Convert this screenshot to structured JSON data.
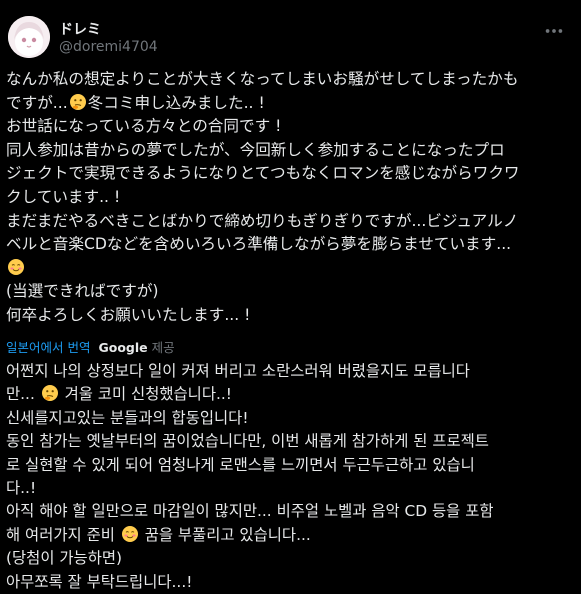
{
  "user": {
    "display_name": "ドレミ",
    "handle": "@doremi4704",
    "avatar_icon": "avatar-icon",
    "more_icon": "more-options-icon"
  },
  "tweet": {
    "original_lines": [
      {
        "before": "なんか私の想定よりことが大きくなってしまいお騒がせしてしまったかも",
        "emoji": "",
        "after": ""
      },
      {
        "before": "ですが...",
        "emoji": "thinking-face-emoji",
        "after": "冬コミ申し込みました.. !"
      },
      {
        "before": "お世話になっている方々との合同です !",
        "emoji": "",
        "after": ""
      },
      {
        "before": "同人参加は昔からの夢でしたが、今回新しく参加することになったプロ",
        "emoji": "",
        "after": ""
      },
      {
        "before": "ジェクトで実現できるようになりとてつもなくロマンを感じながらワクワ",
        "emoji": "",
        "after": ""
      },
      {
        "before": "クしています.. !",
        "emoji": "",
        "after": ""
      },
      {
        "before": "まだまだやるべきことばかりで締め切りもぎりぎりですが...ビジュアルノ",
        "emoji": "",
        "after": ""
      },
      {
        "before": "ベルと音楽CDなどを含めいろいろ準備しながら夢を膨らませています...",
        "emoji": "",
        "after": ""
      },
      {
        "before": "",
        "emoji": "smiling-face-emoji",
        "after": ""
      },
      {
        "before": "(当選できればですが)",
        "emoji": "",
        "after": ""
      },
      {
        "before": "何卒よろしくお願いいたします... !",
        "emoji": "",
        "after": ""
      }
    ],
    "translated_lines": [
      {
        "before": "어쩐지 나의 상정보다 일이 커져 버리고 소란스러워 버렸을지도 모릅니다",
        "emoji": "",
        "after": ""
      },
      {
        "before": "만... ",
        "emoji": "thinking-face-emoji",
        "after": " 겨울 코미 신청했습니다..!"
      },
      {
        "before": "신세를지고있는 분들과의 합동입니다!",
        "emoji": "",
        "after": ""
      },
      {
        "before": "동인 참가는 옛날부터의 꿈이었습니다만, 이번 새롭게 참가하게 된 프로젝트",
        "emoji": "",
        "after": ""
      },
      {
        "before": "로 실현할 수 있게 되어 엄청나게 로맨스를 느끼면서 두근두근하고 있습니",
        "emoji": "",
        "after": ""
      },
      {
        "before": "다..!",
        "emoji": "",
        "after": ""
      },
      {
        "before": "아직 해야 할 일만으로 마감일이 많지만... 비주얼 노벨과 음악 CD 등을 포함",
        "emoji": "",
        "after": ""
      },
      {
        "before": "해 여러가지 준비 ",
        "emoji": "smiling-face-emoji",
        "after": " 꿈을 부풀리고 있습니다..."
      },
      {
        "before": "(당첨이 가능하면)",
        "emoji": "",
        "after": ""
      },
      {
        "before": "아무쪼록 잘 부탁드립니다...!",
        "emoji": "",
        "after": ""
      }
    ]
  },
  "translation_bar": {
    "link_text": "일본어에서 번역",
    "google_text": "Google",
    "provider_suffix": "제공"
  },
  "colors": {
    "background": "#000000",
    "text": "#e7e9ea",
    "secondary": "#71767b",
    "link": "#1d9bf0"
  }
}
